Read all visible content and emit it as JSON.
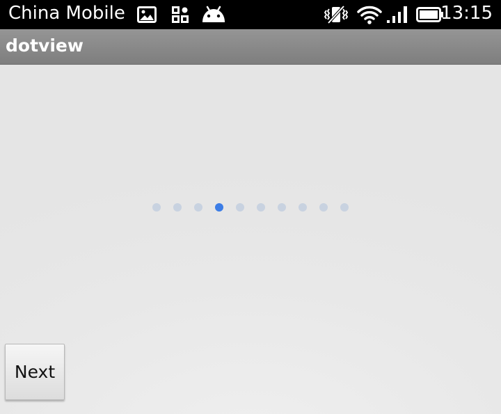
{
  "status_bar": {
    "carrier": "China Mobile",
    "time": "13:15",
    "icons": [
      "image-icon",
      "qr-code-icon",
      "android-icon",
      "vibrate-mute-icon",
      "wifi-icon",
      "signal-icon",
      "battery-icon"
    ]
  },
  "app_bar": {
    "title": "dotview"
  },
  "dot_view": {
    "total": 10,
    "active_index": 3,
    "colors": {
      "inactive": "#c8d2e0",
      "active": "#3c7de6"
    }
  },
  "next_button": {
    "label": "Next"
  }
}
